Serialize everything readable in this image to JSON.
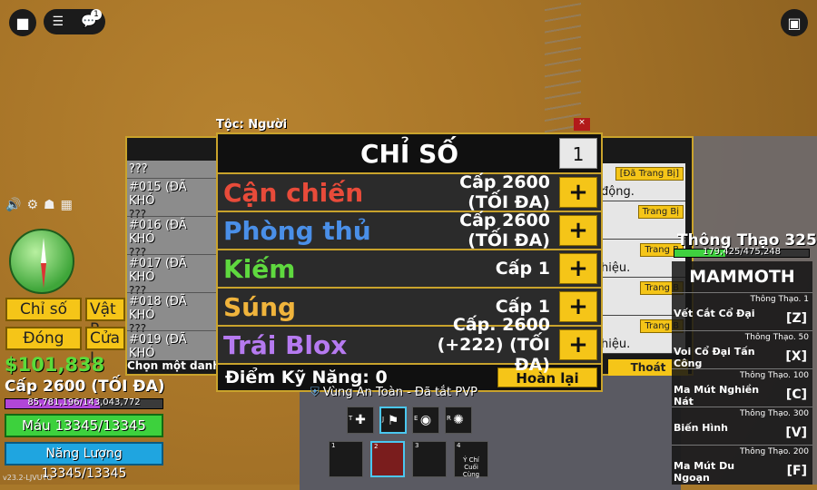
{
  "hud_top": {
    "notif_count": "1"
  },
  "race_label": "Tộc: Người",
  "stats": {
    "title": "CHỈ SỐ",
    "points": "1",
    "rows": [
      {
        "name": "Cận chiến",
        "value": "Cấp 2600 (TỐI ĐA)",
        "color": "#e84b3a"
      },
      {
        "name": "Phòng thủ",
        "value": "Cấp 2600 (TỐI ĐA)",
        "color": "#4a8fe8"
      },
      {
        "name": "Kiếm",
        "value": "Cấp 1",
        "color": "#5fd93f"
      },
      {
        "name": "Súng",
        "value": "Cấp 1",
        "color": "#f0b43c"
      },
      {
        "name": "Trái Blox",
        "value": "Cấp. 2600 (+222) (TỐI ĐA)",
        "color": "#b67af0"
      }
    ],
    "plus_label": "+",
    "skill_points": "Điểm Kỹ Năng: 0",
    "reset_label": "Hoàn lại"
  },
  "quests": {
    "top": "???",
    "items": [
      {
        "id": "#015 (ĐÃ KHÓ",
        "desc": "???"
      },
      {
        "id": "#016 (ĐÃ KHÓ",
        "desc": "???"
      },
      {
        "id": "#017 (ĐÃ KHÓ",
        "desc": "???"
      },
      {
        "id": "#018 (ĐÃ KHÓ",
        "desc": "???"
      },
      {
        "id": "#019 (ĐÃ KHÓ",
        "desc": "???"
      }
    ],
    "choose": "Chọn một danh l"
  },
  "equip_list": [
    {
      "btn": "[Đã Trang Bị]",
      "text": "động."
    },
    {
      "btn": "Trang Bị",
      "text": ""
    },
    {
      "btn": "Trang B",
      "text": "hiệu."
    },
    {
      "btn": "Trang B",
      "text": ""
    },
    {
      "btn": "Trang B",
      "text": "hiệu."
    }
  ],
  "exit_label": "Thoát",
  "left_hud": {
    "btn_stats": "Chỉ số",
    "btn_items": "Vật P",
    "btn_close": "Đóng",
    "btn_shop": "Cửa I",
    "money": "$101,838",
    "level": "Cấp 2600 (TỐI ĐA)",
    "xp": "85,781,196/143,043,772",
    "xp_fraction": 0.6,
    "hp": "Máu 13345/13345",
    "energy": "Năng Lượng 13345/13345",
    "version": "v23.2-LJVUTO"
  },
  "right_panel": {
    "mastery_title": "Thông Thạo 325",
    "mastery_xp": "179,425/475,248",
    "fruit_name": "MAMMOTH",
    "moves": [
      {
        "name": "Vết Cắt Cổ Đại",
        "level": "Thông Thạo. 1",
        "key": "[Z]"
      },
      {
        "name": "Voi Cổ Đại Tấn Công",
        "level": "Thông Thạo. 50",
        "key": "[X]"
      },
      {
        "name": "Ma Mút Nghiền Nát",
        "level": "Thông Thạo. 100",
        "key": "[C]"
      },
      {
        "name": "Biến Hình",
        "level": "Thông Thạo. 300",
        "key": "[V]"
      },
      {
        "name": "Ma Mút Du Ngoạn",
        "level": "Thông Thạo. 200",
        "key": "[F]"
      }
    ]
  },
  "zone": "Vùng An Toàn - Đã tắt PVP",
  "hotbar": {
    "skills": [
      {
        "key": "T",
        "icon": "✚"
      },
      {
        "key": "J",
        "icon": "⚑"
      },
      {
        "key": "E",
        "icon": "◉"
      },
      {
        "key": "R",
        "icon": "✺"
      }
    ],
    "slots": [
      {
        "key": "1",
        "label": ""
      },
      {
        "key": "2",
        "label": ""
      },
      {
        "key": "3",
        "label": ""
      },
      {
        "key": "4",
        "label": "Ý Chí Cuối Cùng"
      }
    ]
  }
}
